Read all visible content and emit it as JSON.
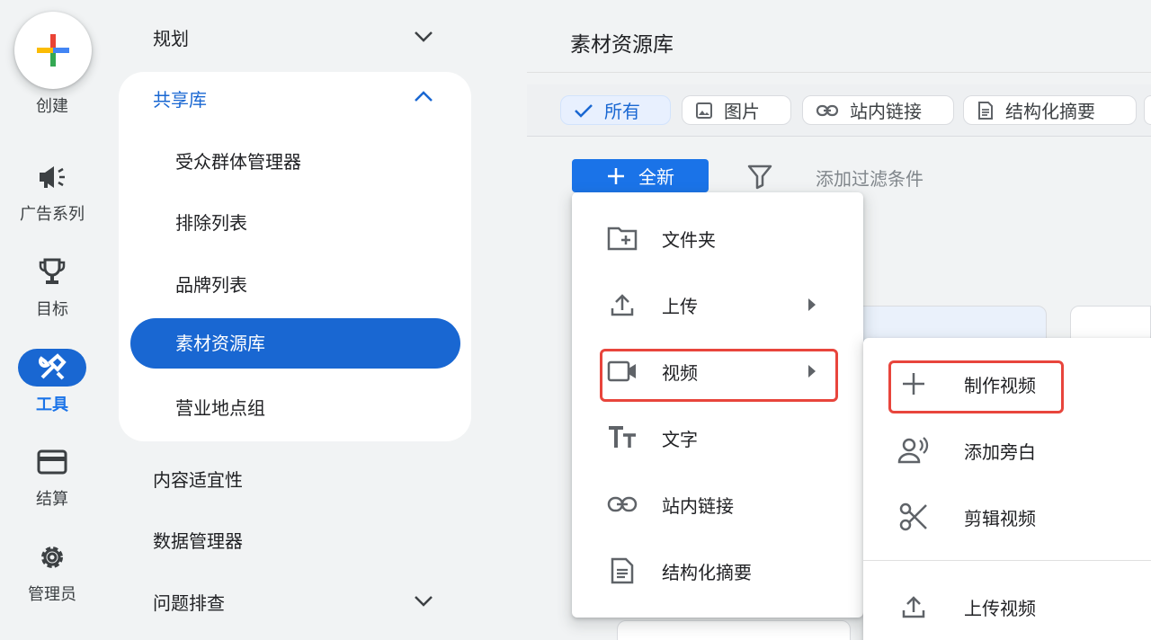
{
  "rail": {
    "create_label": "创建",
    "items": [
      {
        "label": "广告系列",
        "icon": "megaphone-icon"
      },
      {
        "label": "目标",
        "icon": "trophy-icon"
      },
      {
        "label": "工具",
        "icon": "tools-icon",
        "active": true
      },
      {
        "label": "结算",
        "icon": "credit-card-icon"
      },
      {
        "label": "管理员",
        "icon": "gear-icon"
      }
    ]
  },
  "nav": {
    "planning": "规划",
    "shared_library": "共享库",
    "shared_items": [
      "受众群体管理器",
      "排除列表",
      "品牌列表",
      "素材资源库",
      "营业地点组"
    ],
    "active_item": "素材资源库",
    "content_suitability": "内容适宜性",
    "data_manager": "数据管理器",
    "troubleshooting": "问题排查"
  },
  "main": {
    "title": "素材资源库",
    "chips": [
      "所有",
      "图片",
      "站内链接",
      "结构化摘要"
    ],
    "new_button": "全新",
    "filter_placeholder": "添加过滤条件"
  },
  "new_menu": {
    "items": [
      "文件夹",
      "上传",
      "视频",
      "文字",
      "站内链接",
      "结构化摘要"
    ]
  },
  "video_submenu": {
    "items": [
      "制作视频",
      "添加旁白",
      "剪辑视频",
      "上传视频"
    ]
  },
  "colors": {
    "accent": "#1a73e8",
    "active_nav": "#1967d2",
    "highlight_box": "#e8453c"
  }
}
